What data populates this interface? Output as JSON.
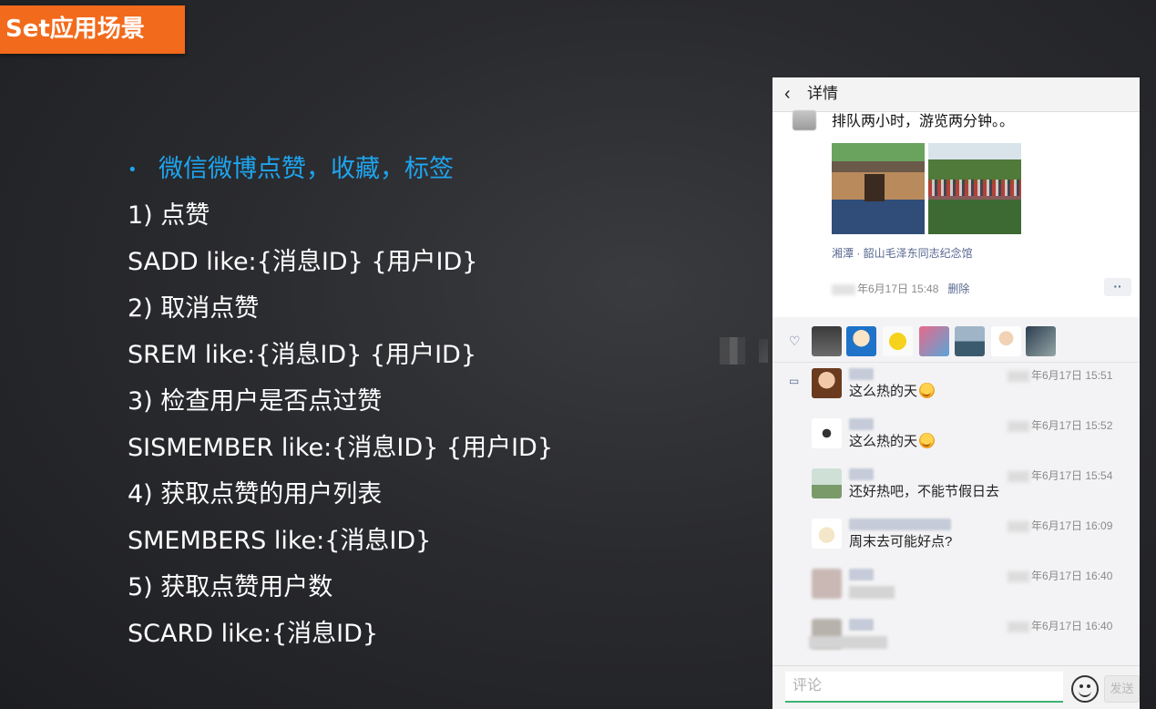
{
  "slide": {
    "title": "Set应用场景",
    "bullet": "微信微博点赞，收藏，标签",
    "lines": [
      "1) 点赞",
      "SADD  like:{消息ID}  {用户ID}",
      "2) 取消点赞",
      "SREM like:{消息ID}  {用户ID}",
      "3) 检查用户是否点过赞",
      "SISMEMBER  like:{消息ID}  {用户ID}",
      "4) 获取点赞的用户列表",
      "SMEMBERS like:{消息ID}",
      "5) 获取点赞用户数",
      "SCARD like:{消息ID}"
    ],
    "colors": {
      "accent": "#f26a1b",
      "bullet": "#1ea5ef",
      "text": "#ffffff",
      "background": "#2a2b2f"
    }
  },
  "phone": {
    "header": {
      "back_icon": "chevron-left-icon",
      "back_glyph": "‹",
      "title": "详情"
    },
    "post": {
      "text": "排队两小时，游览两分钟。。",
      "location": "湘潭 · 韶山毛泽东同志纪念馆",
      "time": "年6月17日 15:48",
      "delete_label": "删除",
      "more_label": "··"
    },
    "like_icon": "heart-icon",
    "comment_icon": "comment-icon",
    "comments": [
      {
        "time": "年6月17日 15:51",
        "text": "这么热的天",
        "emoji": true
      },
      {
        "time": "年6月17日 15:52",
        "text": "这么热的天",
        "emoji": true
      },
      {
        "time": "年6月17日 15:54",
        "text": "还好热吧，不能节假日去",
        "emoji": false
      },
      {
        "time": "年6月17日 16:09",
        "text": "周末去可能好点?",
        "emoji": false
      },
      {
        "time": "年6月17日 16:40",
        "text": "",
        "emoji": false
      },
      {
        "time": "年6月17日 16:40",
        "text": "",
        "emoji": false
      }
    ],
    "footer": {
      "input_placeholder": "评论",
      "send_label": "发送",
      "emoji_icon": "smiley-icon"
    }
  }
}
